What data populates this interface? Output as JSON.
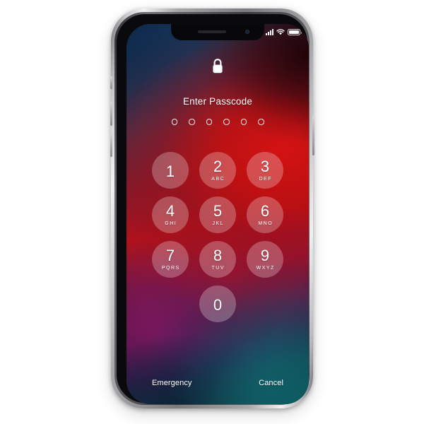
{
  "device": {
    "name": "iPhone X",
    "frame_color": "#b9b9bd",
    "bezel_color": "#0a0a0c",
    "hardware_buttons": [
      {
        "name": "mute-switch",
        "label": "Ring/Silent switch"
      },
      {
        "name": "volume-up-button",
        "label": "Volume Up"
      },
      {
        "name": "volume-down-button",
        "label": "Volume Down"
      },
      {
        "name": "power-button",
        "label": "Side Button"
      }
    ]
  },
  "status_bar": {
    "signal_icon": "signal-bars-icon",
    "signal_bars": 4,
    "wifi_icon": "wifi-icon",
    "battery_icon": "battery-icon",
    "battery_level_percent": 100
  },
  "lock_screen": {
    "lock_icon": "lock-closed-icon",
    "title": "Enter Passcode",
    "passcode_length": 6,
    "passcode_entered": 0,
    "dot_states": [
      false,
      false,
      false,
      false,
      false,
      false
    ]
  },
  "keypad": {
    "keys": [
      {
        "digit": "1",
        "letters": ""
      },
      {
        "digit": "2",
        "letters": "ABC"
      },
      {
        "digit": "3",
        "letters": "DEF"
      },
      {
        "digit": "4",
        "letters": "GHI"
      },
      {
        "digit": "5",
        "letters": "JKL"
      },
      {
        "digit": "6",
        "letters": "MNO"
      },
      {
        "digit": "7",
        "letters": "PQRS"
      },
      {
        "digit": "8",
        "letters": "TUV"
      },
      {
        "digit": "9",
        "letters": "WXYZ"
      },
      {
        "digit": "0",
        "letters": ""
      }
    ]
  },
  "actions": {
    "emergency_label": "Emergency",
    "cancel_label": "Cancel"
  },
  "wallpaper": {
    "type": "multicolor-gradient",
    "colors": {
      "top_left_navy": "#17365c",
      "top_right_dark_maroon": "#2a040a",
      "mid_right_red": "#c40f0f",
      "bottom_left_magenta": "#7e1660",
      "bottom_left_navy": "#172a4d",
      "bottom_right_teal": "#166b71"
    }
  }
}
